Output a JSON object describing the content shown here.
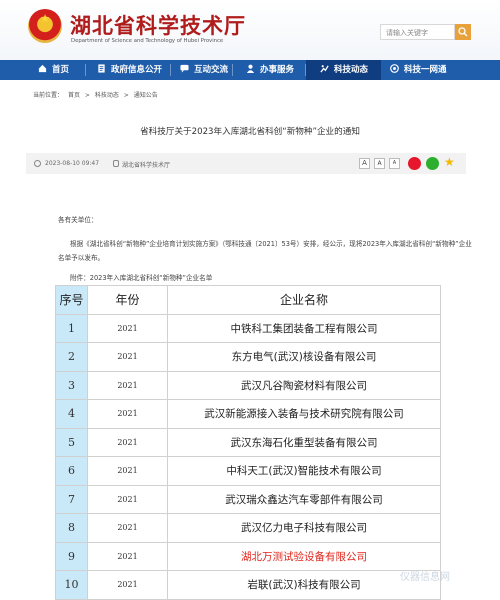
{
  "header": {
    "title": "湖北省科学技术厅",
    "subtitle": "Department of Science and Technology of Hubei Province",
    "search_placeholder": "请输入关键字"
  },
  "nav": [
    {
      "label": "首页",
      "icon": "home-icon"
    },
    {
      "label": "政府信息公开",
      "icon": "document-icon"
    },
    {
      "label": "互动交流",
      "icon": "chat-icon"
    },
    {
      "label": "办事服务",
      "icon": "person-icon"
    },
    {
      "label": "科技动态",
      "icon": "news-icon",
      "active": true
    },
    {
      "label": "科技一网通",
      "icon": "grid-icon"
    }
  ],
  "breadcrumb": [
    "当前位置：",
    "首页",
    ">",
    "科技动态",
    ">",
    "通知公告"
  ],
  "article": {
    "title": "省科技厅关于2023年入库湖北省科创“新物种”企业的通知",
    "date": "2023-08-10 09:47",
    "source": "湖北省科学技术厅",
    "font_buttons": [
      "A",
      "A",
      "A"
    ],
    "salutation": "各有关单位：",
    "paragraph": "根据《湖北省科创“新物种”企业培育计划实施方案》（鄂科技通〔2021〕53号）安排，经公示，现将2023年入库湖北省科创“新物种”企业名单予以发布。",
    "attachment": "附件：2023年入库湖北省科创“新物种”企业名单"
  },
  "table": {
    "headers": [
      "序号",
      "年份",
      "企业名称"
    ],
    "rows": [
      {
        "no": "1",
        "year": "2021",
        "name": "中铁科工集团装备工程有限公司"
      },
      {
        "no": "2",
        "year": "2021",
        "name": "东方电气(武汉)核设备有限公司"
      },
      {
        "no": "3",
        "year": "2021",
        "name": "武汉凡谷陶瓷材料有限公司"
      },
      {
        "no": "4",
        "year": "2021",
        "name": "武汉新能源接入装备与技术研究院有限公司"
      },
      {
        "no": "5",
        "year": "2021",
        "name": "武汉东海石化重型装备有限公司"
      },
      {
        "no": "6",
        "year": "2021",
        "name": "中科天工(武汉)智能技术有限公司"
      },
      {
        "no": "7",
        "year": "2021",
        "name": "武汉瑞众鑫达汽车零部件有限公司"
      },
      {
        "no": "8",
        "year": "2021",
        "name": "武汉亿力电子科技有限公司"
      },
      {
        "no": "9",
        "year": "2021",
        "name": "湖北万测试验设备有限公司",
        "highlight": true
      },
      {
        "no": "10",
        "year": "2021",
        "name": "岩联(武汉)科技有限公司"
      }
    ]
  },
  "watermark": "仪器信息网",
  "colors": {
    "nav": "#1f5dab",
    "title_red": "#b01c1c",
    "highlight": "#e0261c",
    "index_col": "#c9e8f8"
  }
}
